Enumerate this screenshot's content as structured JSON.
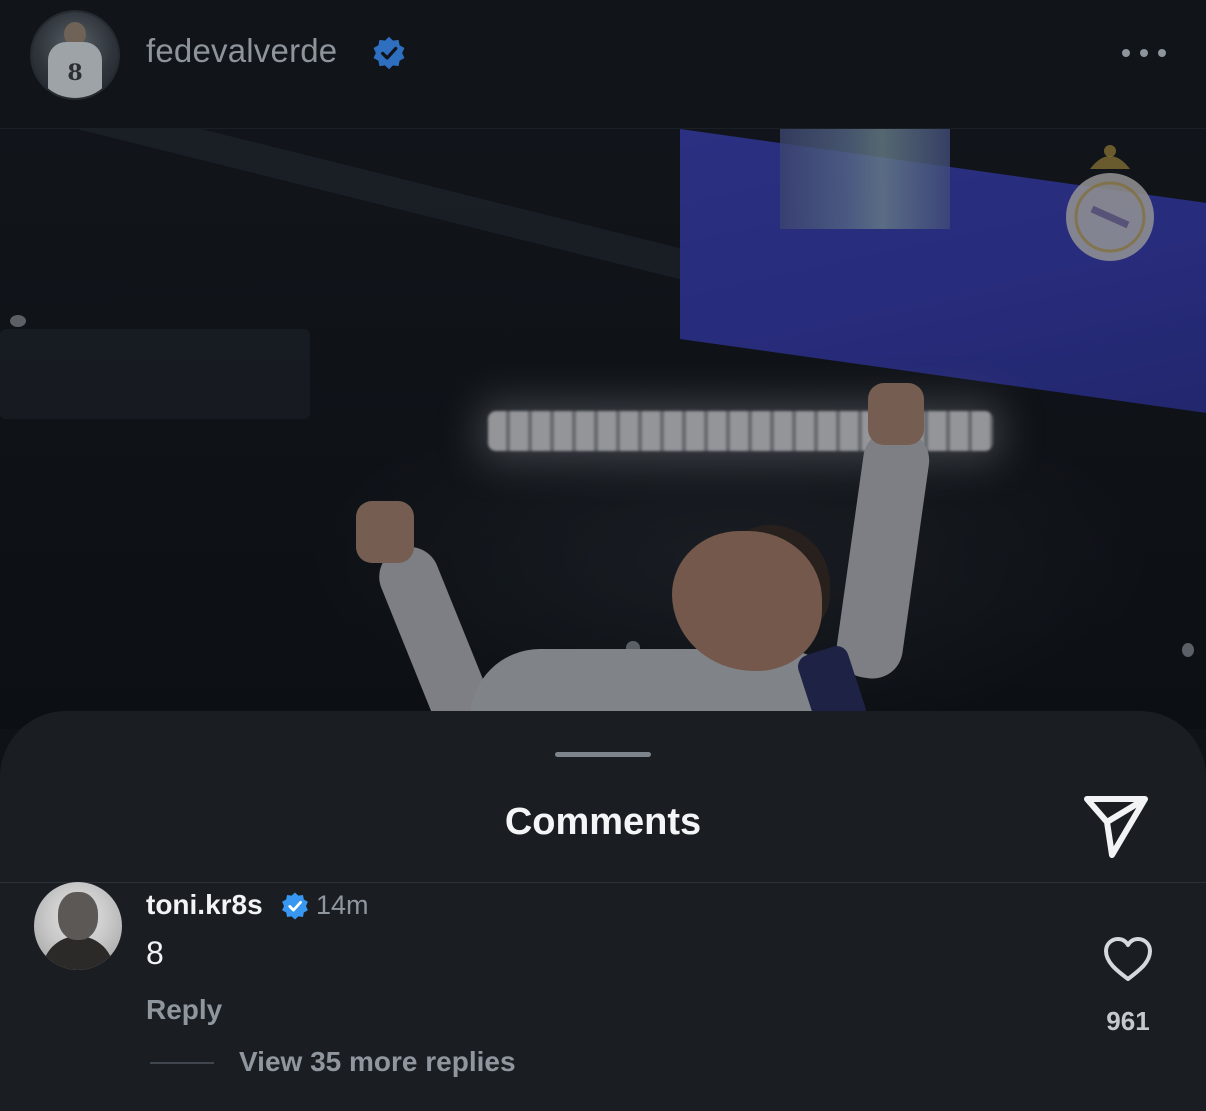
{
  "post": {
    "username": "fedevalverde",
    "verified": true,
    "more_icon": "more-horizontal-icon"
  },
  "sheet": {
    "title": "Comments",
    "share_icon": "send-icon"
  },
  "comment": {
    "username": "toni.kr8s",
    "verified": true,
    "time": "14m",
    "text": "8",
    "reply_label": "Reply",
    "like_icon": "heart-icon",
    "like_count": "961",
    "view_replies_label": "View 35 more replies"
  },
  "colors": {
    "background": "#0f1216",
    "sheet": "#1a1e23",
    "verified_blue": "#3897f0",
    "secondary_text": "#8f969d"
  }
}
